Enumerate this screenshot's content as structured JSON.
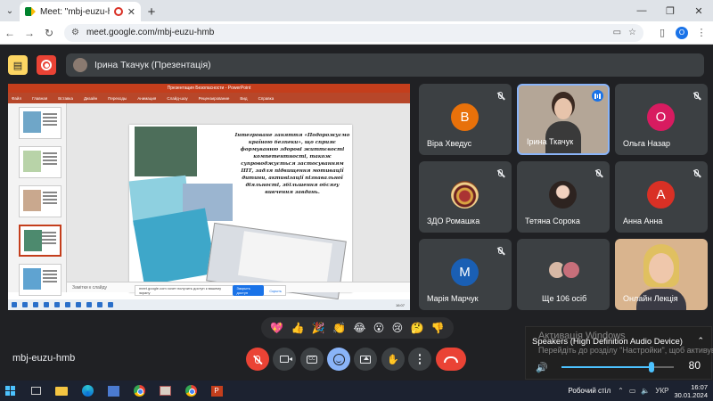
{
  "browser": {
    "tab_title": "Meet: \"mbj-euzu-hmb\"",
    "url": "meet.google.com/mbj-euzu-hmb",
    "profile_initial": "O"
  },
  "meet": {
    "presenting_label": "Ірина Ткачук (Презентація)",
    "meeting_code": "mbj-euzu-hmb"
  },
  "shared_screen": {
    "slide_text": "Інтегроване заняття «Подорожуємо країною безпеки», що сприяє формуванню здорові життєвості компетентності, також супроводжується застосуванням ІПТ, задля підвищення мотивації дитини, активізації пізнавальної діяльності, збільшення обсягу вивчення завдань.",
    "notes_placeholder": "Замітки к слайду",
    "banner_text": "meet.google.com хочет получить доступ к вашему экрану",
    "banner_button": "Закрыть доступ",
    "banner_link": "Скрыть",
    "ribbon": [
      "Файл",
      "Главная",
      "Вставка",
      "Дизайн",
      "Переходы",
      "Анимация",
      "Слайд-шоу",
      "Рецензирование",
      "Вид",
      "Справка"
    ],
    "window_title": "Презентация Безопасности - PowerPoint"
  },
  "participants": [
    {
      "name": "Віра Хведус",
      "initial": "В",
      "color": "#e8710a"
    },
    {
      "name": "Ірина Ткачук",
      "initial": "",
      "color": ""
    },
    {
      "name": "Ольга Назар",
      "initial": "О",
      "color": "#d81b60"
    },
    {
      "name": "ЗДО Ромашка",
      "initial": "",
      "color": ""
    },
    {
      "name": "Тетяна Сорока",
      "initial": "",
      "color": ""
    },
    {
      "name": "Анна Анна",
      "initial": "А",
      "color": "#d93025"
    },
    {
      "name": "Марія Марчук",
      "initial": "М",
      "color": "#1a5fb4"
    },
    {
      "name": "Ще 106 осіб",
      "initial": "",
      "color": ""
    },
    {
      "name": "Онлайн Лекція",
      "initial": "",
      "color": ""
    }
  ],
  "reactions": [
    "💖",
    "👍",
    "🎉",
    "👏",
    "😂",
    "😮",
    "😢",
    "🤔",
    "👎"
  ],
  "volume": {
    "device": "Speakers (High Definition Audio Device)",
    "level": 80,
    "watermark_title": "Активація Windows",
    "watermark_sub": "Перейдіть до розділу \"Настройки\", щоб активувати Windows."
  },
  "taskbar": {
    "desktop_label": "Робочий стіл",
    "lang": "УКР",
    "time": "16:07",
    "date": "30.01.2024"
  }
}
